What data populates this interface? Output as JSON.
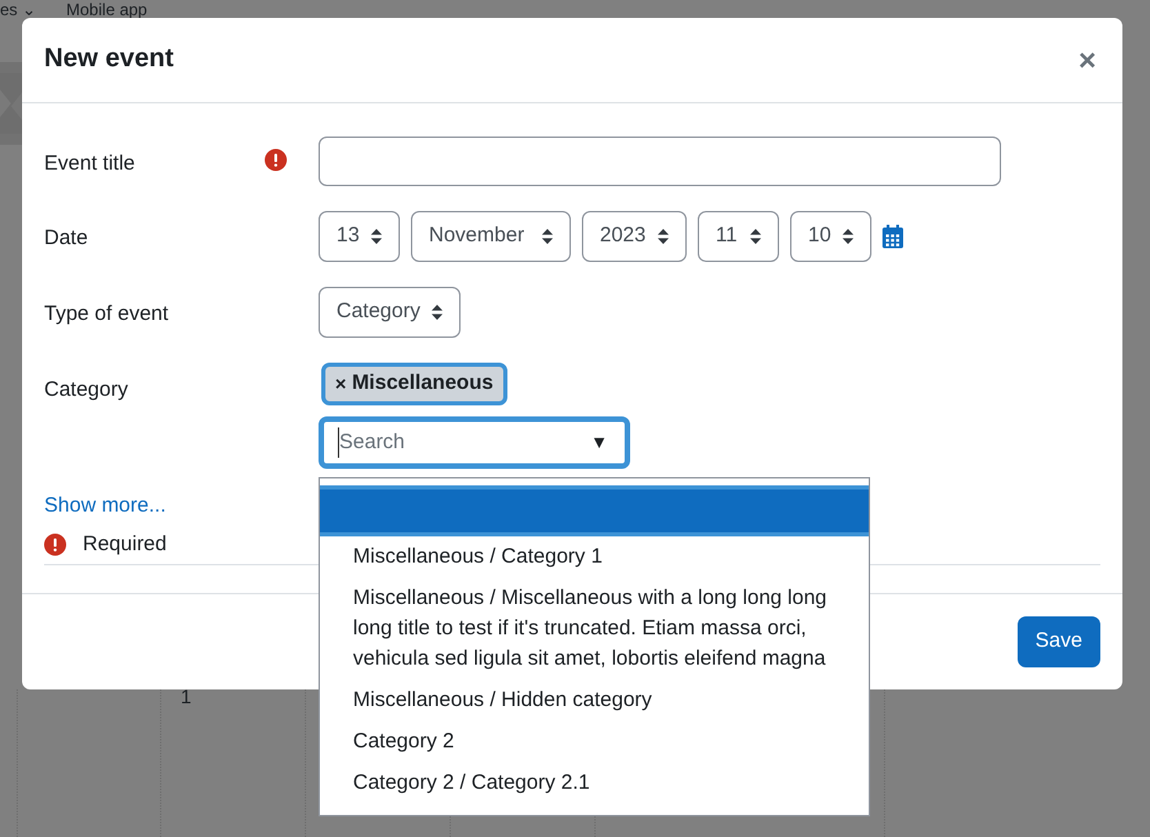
{
  "background": {
    "nav": [
      {
        "label": "es ⌄"
      },
      {
        "label": "Mobile app"
      }
    ],
    "calendar_day": "1"
  },
  "dialog": {
    "title": "New event",
    "close": "×",
    "fields": [
      {
        "kind": "text",
        "label": "Event title",
        "required": true
      },
      {
        "kind": "date",
        "label": "Date",
        "selects": [
          "13",
          "November",
          "2023",
          "11",
          "10"
        ]
      },
      {
        "kind": "select",
        "label": "Type of event",
        "value": "Category"
      },
      {
        "kind": "autocomplete",
        "label": "Category",
        "chip": {
          "remove": "×",
          "label": "Miscellaneous"
        },
        "placeholder": "Search",
        "toggle": "▼",
        "options": [
          {
            "selected": true
          },
          {
            "label": "Miscellaneous / Category 1",
            "selected": false
          },
          {
            "label": "Miscellaneous / Miscellaneous with a long long long long title to test if it's truncated. Etiam massa orci, vehicula sed ligula sit amet, lobortis eleifend magna",
            "selected": false
          },
          {
            "label": "Miscellaneous / Hidden category",
            "selected": false
          },
          {
            "label": "Category 2",
            "selected": false
          },
          {
            "label": "Category 2 / Category 2.1",
            "selected": false
          }
        ]
      }
    ],
    "show_more": "Show more...",
    "required_note": "Required",
    "save": "Save"
  }
}
